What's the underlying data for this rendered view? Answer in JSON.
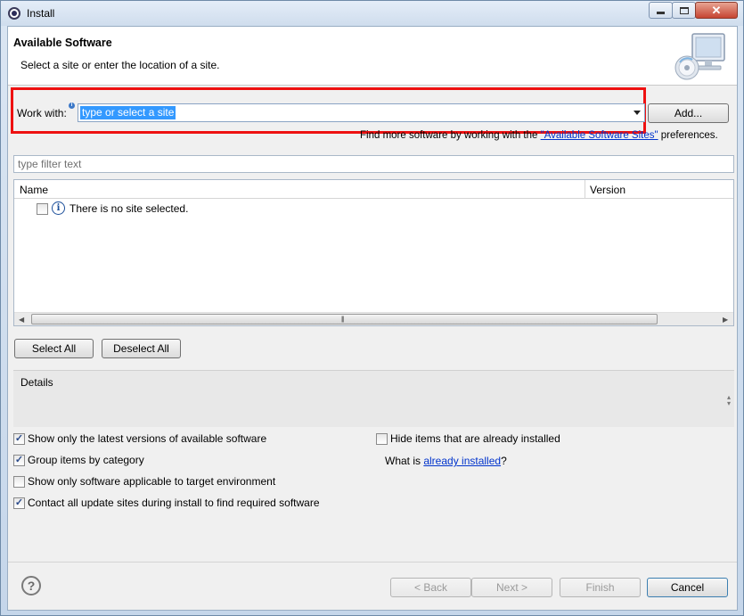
{
  "window": {
    "title": "Install"
  },
  "header": {
    "title": "Available Software",
    "description": "Select a site or enter the location of a site."
  },
  "work_with": {
    "label": "Work with:",
    "value": "type or select a site",
    "add_label": "Add..."
  },
  "prefs": {
    "prefix": "Find more software by working with the ",
    "link": "\"Available Software Sites\"",
    "suffix": " preferences."
  },
  "filter": {
    "placeholder": "type filter text"
  },
  "table": {
    "columns": [
      "Name",
      "Version"
    ],
    "rows": [
      {
        "name": "There is no site selected.",
        "checked": false
      }
    ]
  },
  "selection_buttons": {
    "select_all": "Select All",
    "deselect_all": "Deselect All"
  },
  "details": {
    "label": "Details"
  },
  "options": {
    "latest_versions": {
      "label": "Show only the latest versions of available software",
      "checked": true
    },
    "group_by_category": {
      "label": "Group items by category",
      "checked": true
    },
    "target_env_only": {
      "label": "Show only software applicable to target environment",
      "checked": false
    },
    "contact_all_sites": {
      "label": "Contact all update sites during install to find required software",
      "checked": true
    },
    "hide_installed": {
      "label": "Hide items that are already installed",
      "checked": false
    },
    "what_is_prefix": "What is ",
    "what_is_link": "already installed",
    "what_is_suffix": "?"
  },
  "footer": {
    "back": "< Back",
    "next": "Next >",
    "finish": "Finish",
    "cancel": "Cancel"
  },
  "colors": {
    "highlight": "#ee1111",
    "link": "#0033cc",
    "selection": "#3399ff"
  }
}
